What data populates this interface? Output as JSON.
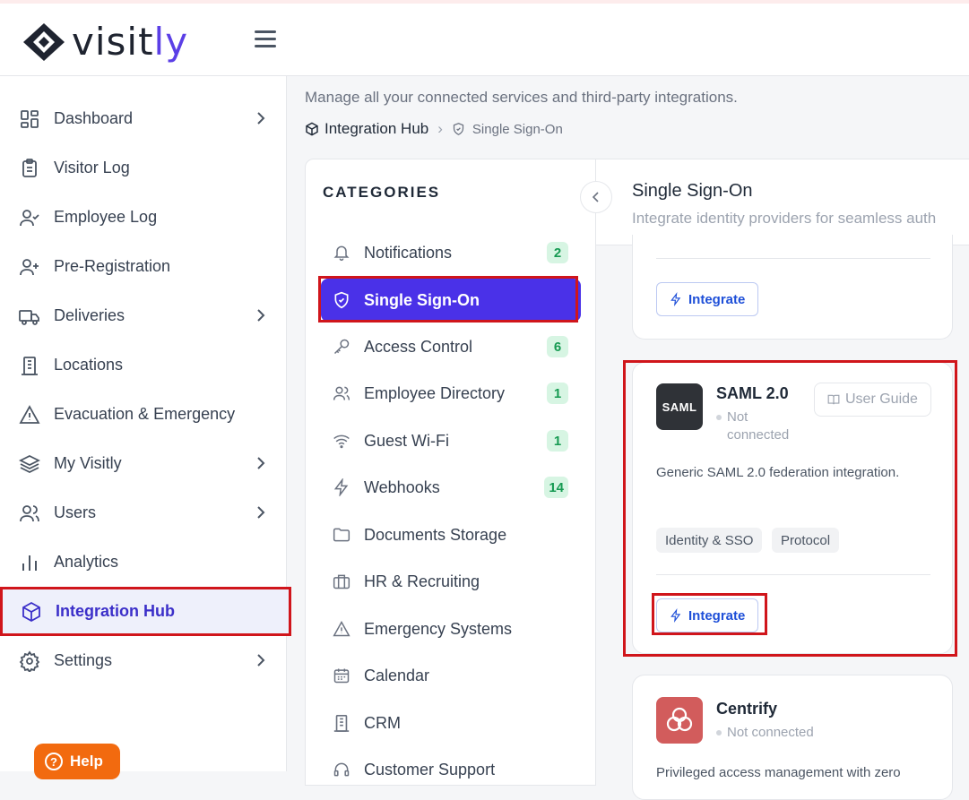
{
  "brand": {
    "logo_text_a": "visit",
    "logo_text_b": "ly",
    "color": "#5b3fe6"
  },
  "sidebar": {
    "items": [
      {
        "label": "Dashboard",
        "icon": "dashboard-grid-icon",
        "has_chevron": true
      },
      {
        "label": "Visitor Log",
        "icon": "clipboard-icon",
        "has_chevron": false
      },
      {
        "label": "Employee Log",
        "icon": "user-check-icon",
        "has_chevron": false
      },
      {
        "label": "Pre-Registration",
        "icon": "user-plus-icon",
        "has_chevron": false
      },
      {
        "label": "Deliveries",
        "icon": "truck-icon",
        "has_chevron": true
      },
      {
        "label": "Locations",
        "icon": "building-icon",
        "has_chevron": false
      },
      {
        "label": "Evacuation & Emergency",
        "icon": "warning-icon",
        "has_chevron": false
      },
      {
        "label": "My Visitly",
        "icon": "layers-icon",
        "has_chevron": true
      },
      {
        "label": "Users",
        "icon": "users-icon",
        "has_chevron": true
      },
      {
        "label": "Analytics",
        "icon": "bar-chart-icon",
        "has_chevron": false
      },
      {
        "label": "Integration Hub",
        "icon": "cube-icon",
        "has_chevron": false,
        "active": true
      },
      {
        "label": "Settings",
        "icon": "gear-icon",
        "has_chevron": true
      }
    ],
    "help_label": "Help"
  },
  "page": {
    "subtitle": "Manage all your connected services and third-party integrations.",
    "breadcrumb": {
      "root": "Integration Hub",
      "current": "Single Sign-On"
    }
  },
  "categories": {
    "title": "CATEGORIES",
    "items": [
      {
        "label": "Notifications",
        "badge": "2"
      },
      {
        "label": "Single Sign-On",
        "badge": "",
        "active": true
      },
      {
        "label": "Access Control",
        "badge": "6"
      },
      {
        "label": "Employee Directory",
        "badge": "1"
      },
      {
        "label": "Guest Wi-Fi",
        "badge": "1"
      },
      {
        "label": "Webhooks",
        "badge": "14"
      },
      {
        "label": "Documents Storage",
        "badge": ""
      },
      {
        "label": "HR & Recruiting",
        "badge": ""
      },
      {
        "label": "Emergency Systems",
        "badge": ""
      },
      {
        "label": "Calendar",
        "badge": ""
      },
      {
        "label": "CRM",
        "badge": ""
      },
      {
        "label": "Customer Support",
        "badge": ""
      }
    ]
  },
  "content": {
    "title": "Single Sign-On",
    "description": "Integrate identity providers for seamless auth"
  },
  "cards": {
    "prev": {
      "integrate_label": "Integrate"
    },
    "saml": {
      "icon_text": "SAML",
      "name": "SAML 2.0",
      "status_line1": "Not",
      "status_line2": "connected",
      "guide_label": "User Guide",
      "description": "Generic SAML 2.0 federation integration.",
      "tags": [
        "Identity & SSO",
        "Protocol"
      ],
      "integrate_label": "Integrate"
    },
    "centrify": {
      "name": "Centrify",
      "status": "Not connected",
      "description": "Privileged access management with zero"
    }
  }
}
